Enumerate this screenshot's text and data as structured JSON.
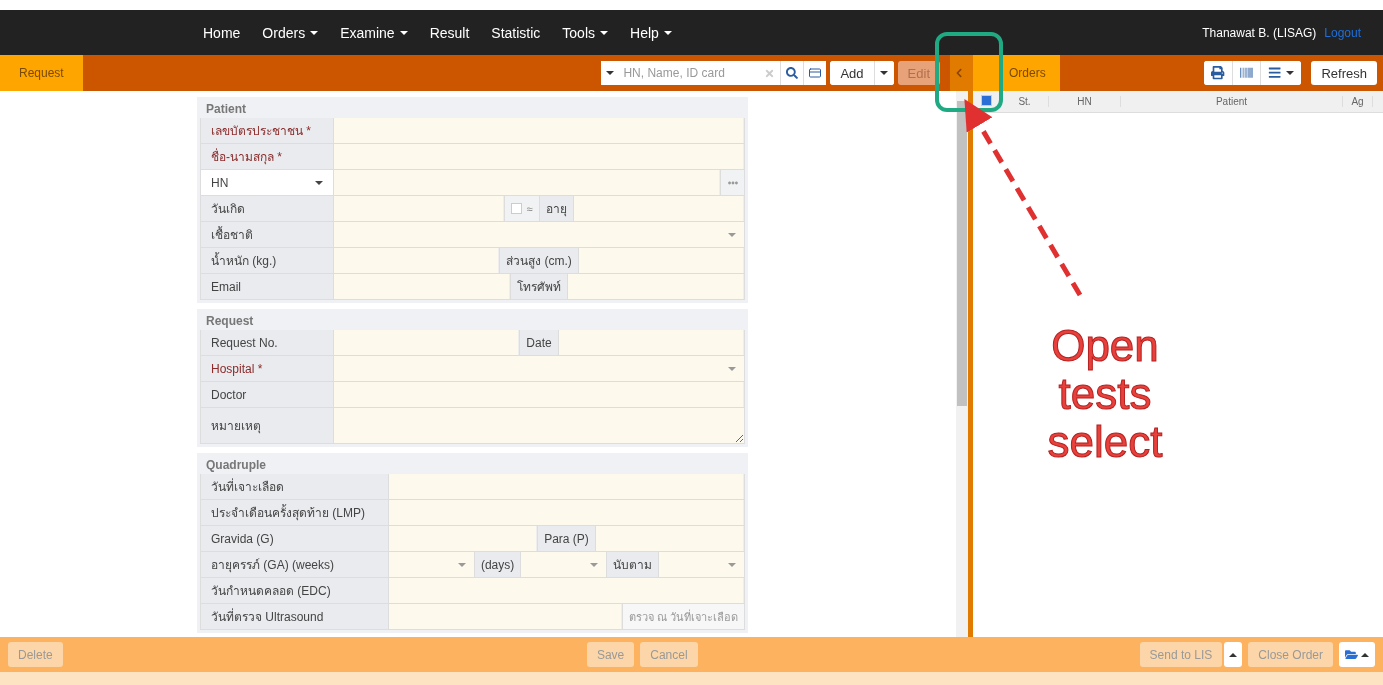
{
  "navbar": {
    "menu": [
      {
        "label": "Home",
        "dropdown": false
      },
      {
        "label": "Orders",
        "dropdown": true
      },
      {
        "label": "Examine",
        "dropdown": true
      },
      {
        "label": "Result",
        "dropdown": false
      },
      {
        "label": "Statistic",
        "dropdown": false
      },
      {
        "label": "Tools",
        "dropdown": true
      },
      {
        "label": "Help",
        "dropdown": true
      }
    ],
    "user": "Thanawat B. (LISAG)",
    "logout": "Logout"
  },
  "left_panel": {
    "title": "Request",
    "search": {
      "placeholder": "HN, Name, ID card"
    },
    "buttons": [
      {
        "kind": "split",
        "label": "Add",
        "disabled": false
      },
      {
        "kind": "plain",
        "label": "Edit",
        "disabled": true
      }
    ]
  },
  "form": {
    "sections": [
      {
        "title": "Patient",
        "rows": [
          [
            {
              "kind": "label",
              "text": "เลขบัตรประชาชน *",
              "required": true
            },
            {
              "kind": "input"
            }
          ],
          [
            {
              "kind": "label",
              "text": "ชื่อ-นามสกุล *",
              "required": true
            },
            {
              "kind": "input"
            }
          ],
          [
            {
              "kind": "picker",
              "text": "HN"
            },
            {
              "kind": "input"
            },
            {
              "kind": "more"
            }
          ],
          [
            {
              "kind": "label",
              "text": "วันเกิด",
              "required": false
            },
            {
              "kind": "input"
            },
            {
              "kind": "check",
              "text": "≈",
              "checked": false
            },
            {
              "kind": "addon",
              "text": "อายุ"
            },
            {
              "kind": "input"
            }
          ],
          [
            {
              "kind": "label",
              "text": "เชื้อชาติ",
              "required": false
            },
            {
              "kind": "select"
            }
          ],
          [
            {
              "kind": "label",
              "text": "น้ำหนัก (kg.)",
              "required": false
            },
            {
              "kind": "input"
            },
            {
              "kind": "addon",
              "text": "ส่วนสูง (cm.)"
            },
            {
              "kind": "input"
            }
          ],
          [
            {
              "kind": "label",
              "text": "Email",
              "required": false
            },
            {
              "kind": "input"
            },
            {
              "kind": "addon",
              "text": "โทรศัพท์"
            },
            {
              "kind": "input"
            }
          ]
        ]
      },
      {
        "title": "Request",
        "rows": [
          [
            {
              "kind": "label",
              "text": "Request No.",
              "required": false
            },
            {
              "kind": "input"
            },
            {
              "kind": "addon",
              "text": "Date"
            },
            {
              "kind": "input"
            }
          ],
          [
            {
              "kind": "label",
              "text": "Hospital *",
              "required": true
            },
            {
              "kind": "select"
            }
          ],
          [
            {
              "kind": "label",
              "text": "Doctor",
              "required": false
            },
            {
              "kind": "input"
            }
          ],
          [
            {
              "kind": "label",
              "text": "หมายเหตุ",
              "required": false
            },
            {
              "kind": "textarea"
            }
          ]
        ]
      },
      {
        "title": "Quadruple",
        "rows": [
          [
            {
              "kind": "label",
              "text": "วันที่เจาะเลือด",
              "required": false
            },
            {
              "kind": "input"
            }
          ],
          [
            {
              "kind": "label",
              "text": "ประจำเดือนครั้งสุดท้าย (LMP)",
              "required": false
            },
            {
              "kind": "input"
            }
          ],
          [
            {
              "kind": "label",
              "text": "Gravida (G)",
              "required": false
            },
            {
              "kind": "input"
            },
            {
              "kind": "addon",
              "text": "Para (P)"
            },
            {
              "kind": "input"
            }
          ],
          [
            {
              "kind": "label",
              "text": "อายุครรภ์ (GA) (weeks)",
              "required": false
            },
            {
              "kind": "select"
            },
            {
              "kind": "addon",
              "text": "(days)"
            },
            {
              "kind": "select"
            },
            {
              "kind": "addon",
              "text": "นับตาม"
            },
            {
              "kind": "select"
            }
          ],
          [
            {
              "kind": "label",
              "text": "วันกำหนดคลอด (EDC)",
              "required": false
            },
            {
              "kind": "input"
            }
          ],
          [
            {
              "kind": "label",
              "text": "วันที่ตรวจ Ultrasound",
              "required": false
            },
            {
              "kind": "input"
            },
            {
              "kind": "action",
              "text": "ตรวจ ณ วันที่เจาะเลือด"
            }
          ]
        ]
      }
    ]
  },
  "right_panel": {
    "title": "Orders",
    "refresh": "Refresh",
    "table": {
      "select_all": {
        "checked": true
      },
      "columns": [
        "St.",
        "HN",
        "Patient",
        "Ag"
      ]
    }
  },
  "footer": {
    "left": [
      "Delete"
    ],
    "center": [
      "Save",
      "Cancel"
    ],
    "right": [
      {
        "kind": "split",
        "label": "Send to LIS"
      },
      {
        "kind": "plain",
        "label": "Close Order"
      }
    ]
  },
  "annotation": {
    "callout": "Open\ntests\nselect"
  }
}
